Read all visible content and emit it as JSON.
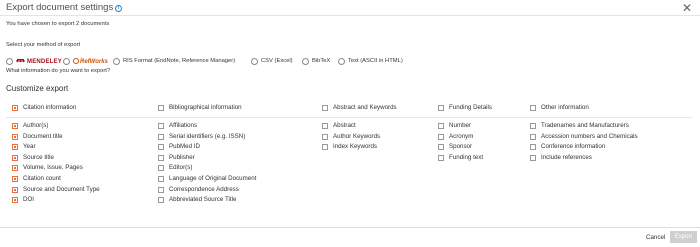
{
  "dialog": {
    "title": "Export document settings",
    "info_icon": "info-icon",
    "close_icon": "close-icon",
    "chosen_text": "You have chosen to export 2 documents",
    "method_prompt": "Select your method of export",
    "what_prompt": "What information do you want to export?",
    "customize_heading": "Customize export"
  },
  "methods": [
    {
      "label": "MENDELEY",
      "brand_color": "#a50f1c"
    },
    {
      "label": "RefWorks",
      "brand_color": "#d35400"
    },
    {
      "label": "RIS Format (EndNote, Reference Manager)"
    },
    {
      "label": "CSV (Excel)"
    },
    {
      "label": "BibTeX"
    },
    {
      "label": "Text (ASCII in HTML)"
    }
  ],
  "groups": [
    {
      "header": {
        "label": "Citation information",
        "checked": true
      },
      "items": [
        {
          "label": "Author(s)",
          "checked": true
        },
        {
          "label": "Document title",
          "checked": true
        },
        {
          "label": "Year",
          "checked": true
        },
        {
          "label": "Source title",
          "checked": true
        },
        {
          "label": "Volume, Issue, Pages",
          "checked": true
        },
        {
          "label": "Citation count",
          "checked": true
        },
        {
          "label": "Source and Document Type",
          "checked": true
        },
        {
          "label": "DOI",
          "checked": true
        }
      ]
    },
    {
      "header": {
        "label": "Bibliographical information",
        "checked": false
      },
      "items": [
        {
          "label": "Affiliations",
          "checked": false
        },
        {
          "label": "Serial identifiers (e.g. ISSN)",
          "checked": false
        },
        {
          "label": "PubMed ID",
          "checked": false
        },
        {
          "label": "Publisher",
          "checked": false
        },
        {
          "label": "Editor(s)",
          "checked": false
        },
        {
          "label": "Language of Original Document",
          "checked": false
        },
        {
          "label": "Correspondence Address",
          "checked": false
        },
        {
          "label": "Abbreviated Source Title",
          "checked": false
        }
      ]
    },
    {
      "header": {
        "label": "Abstract and Keywords",
        "checked": false
      },
      "items": [
        {
          "label": "Abstract",
          "checked": false
        },
        {
          "label": "Author Keywords",
          "checked": false
        },
        {
          "label": "Index Keywords",
          "checked": false
        }
      ]
    },
    {
      "header": {
        "label": "Funding Details",
        "checked": false
      },
      "items": [
        {
          "label": "Number",
          "checked": false
        },
        {
          "label": "Acronym",
          "checked": false
        },
        {
          "label": "Sponsor",
          "checked": false
        },
        {
          "label": "Funding text",
          "checked": false
        }
      ]
    },
    {
      "header": {
        "label": "Other information",
        "checked": false
      },
      "items": [
        {
          "label": "Tradenames and Manufacturers",
          "checked": false
        },
        {
          "label": "Accession numbers and Chemicals",
          "checked": false
        },
        {
          "label": "Conference information",
          "checked": false
        },
        {
          "label": "Include references",
          "checked": false
        }
      ]
    }
  ],
  "footer": {
    "cancel_label": "Cancel",
    "export_label": "Export"
  },
  "colors": {
    "accent_checkbox": "#e2733f",
    "export_disabled": "#cfcfcf"
  }
}
